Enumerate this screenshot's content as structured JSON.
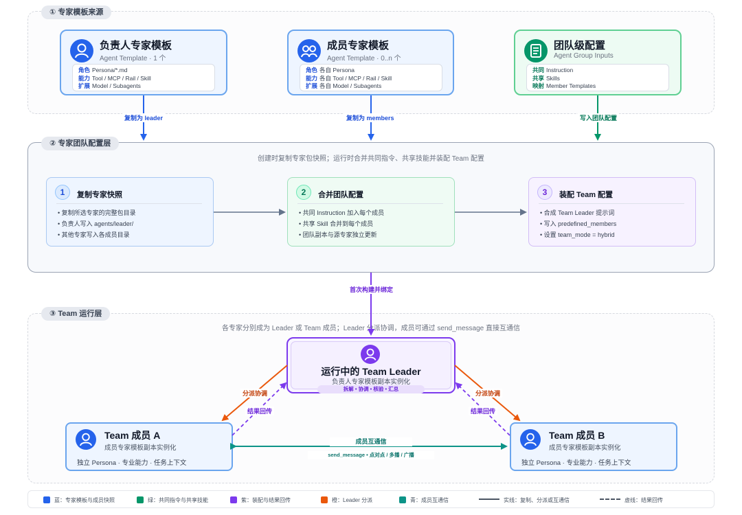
{
  "sections": {
    "s1": "① 专家模板来源",
    "s2": "② 专家团队配置层",
    "s3": "③ Team 运行层"
  },
  "source_cards": {
    "leader": {
      "title": "负责人专家模板",
      "subtitle": "Agent Template · 1 个",
      "rows": [
        {
          "k": "角色",
          "v": "Persona/*.md"
        },
        {
          "k": "能力",
          "v": "Tool / MCP / Rail / Skill"
        },
        {
          "k": "扩展",
          "v": "Model / Subagents"
        }
      ]
    },
    "member": {
      "title": "成员专家模板",
      "subtitle": "Agent Template · 0..n 个",
      "rows": [
        {
          "k": "角色",
          "v": "各自 Persona"
        },
        {
          "k": "能力",
          "v": "各自 Tool / MCP / Rail / Skill"
        },
        {
          "k": "扩展",
          "v": "各自 Model / Subagents"
        }
      ]
    },
    "group": {
      "title": "团队级配置",
      "subtitle": "Agent Group Inputs",
      "rows": [
        {
          "k": "共同",
          "v": "Instruction"
        },
        {
          "k": "共享",
          "v": "Skills"
        },
        {
          "k": "映射",
          "v": "Member Templates"
        }
      ]
    }
  },
  "edges": {
    "copy_leader": "复制为 leader",
    "copy_members": "复制为 members",
    "write_group": "写入团队配置",
    "build_bind": "首次构建并绑定",
    "dispatch": "分派协调",
    "result_back": "结果回传",
    "peer_title": "成员互通信",
    "peer_sub": "send_message • 点对点 / 多播 / 广播"
  },
  "config_layer": {
    "caption": "创建时复制专家包快照；运行时合并共同指令、共享技能并装配 Team 配置",
    "steps": [
      {
        "num": "1",
        "title": "复制专家快照",
        "bullets": [
          "复制所选专家的完整包目录",
          "负责人写入 agents/leader/",
          "其他专家写入各成员目录"
        ]
      },
      {
        "num": "2",
        "title": "合并团队配置",
        "bullets": [
          "共同 Instruction 加入每个成员",
          "共享 Skill 合并到每个成员",
          "团队副本与源专家独立更新"
        ]
      },
      {
        "num": "3",
        "title": "装配 Team 配置",
        "bullets": [
          "合成 Team Leader 提示词",
          "写入 predefined_members",
          "设置 team_mode = hybrid"
        ]
      }
    ]
  },
  "runtime": {
    "caption": "各专家分别成为 Leader 或 Team 成员；Leader 分派协调，成员可通过 send_message 直接互通信",
    "leader": {
      "title": "运行中的 Team Leader",
      "subtitle": "负责人专家模板副本实例化",
      "tag": "拆解 • 协调 • 核验 • 汇总"
    },
    "member_a": {
      "title": "Team 成员 A",
      "subtitle": "成员专家模板副本实例化",
      "desc": "独立 Persona · 专业能力 · 任务上下文"
    },
    "member_b": {
      "title": "Team 成员 B",
      "subtitle": "成员专家模板副本实例化",
      "desc": "独立 Persona · 专业能力 · 任务上下文"
    }
  },
  "legend": [
    {
      "color": "#2563eb",
      "label": "蓝：专家模板与成员快照"
    },
    {
      "color": "#059669",
      "label": "绿：共同指令与共享技能"
    },
    {
      "color": "#7c3aed",
      "label": "紫：装配与结果回传"
    },
    {
      "color": "#ea580c",
      "label": "橙：Leader 分派"
    },
    {
      "color": "#0d9488",
      "label": "青：成员互通信"
    },
    {
      "line": "solid",
      "label": "实线：复制、分派或互通信"
    },
    {
      "line": "dashed",
      "label": "虚线：结果回传"
    }
  ],
  "colors": {
    "blue": "#2563eb",
    "green": "#059669",
    "purple": "#7c3aed",
    "orange": "#ea580c",
    "teal": "#0d9488",
    "gray": "#6b7280"
  }
}
